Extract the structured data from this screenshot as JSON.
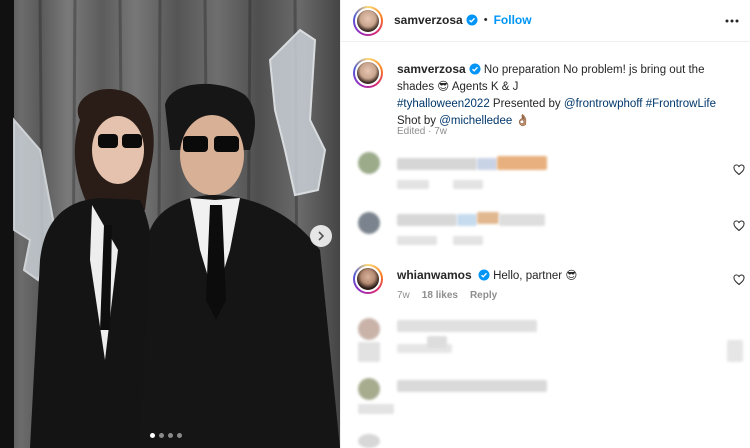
{
  "post": {
    "username": "samverzosa",
    "follow_label": "Follow",
    "separator": "•",
    "caption_username": "samverzosa",
    "caption_text": "No preparation No problem! js bring out the shades",
    "emoji_shades": "😎",
    "caption_agents": "Agents K & J",
    "hashtag1": "#tyhalloween2022",
    "presented_by": "Presented by",
    "mention1": "@frontrowphoff",
    "hashtag2": "#FrontrowLife",
    "shot_by": "Shot by",
    "mention2": "@michelledee",
    "emoji_hand": "👌🏽",
    "edited_meta": "Edited · 7w"
  },
  "comment": {
    "username": "whianwamos",
    "text": "Hello, partner",
    "emoji": "😎",
    "time": "7w",
    "likes": "18 likes",
    "reply": "Reply"
  },
  "colors": {
    "accent": "#0095f6",
    "link": "#00376b",
    "muted": "#8e8e8e"
  },
  "icons": [
    "more-options-icon",
    "verified-badge-icon",
    "heart-icon",
    "chevron-right-icon"
  ],
  "carousel": {
    "slide_count": 4,
    "current": 1
  }
}
